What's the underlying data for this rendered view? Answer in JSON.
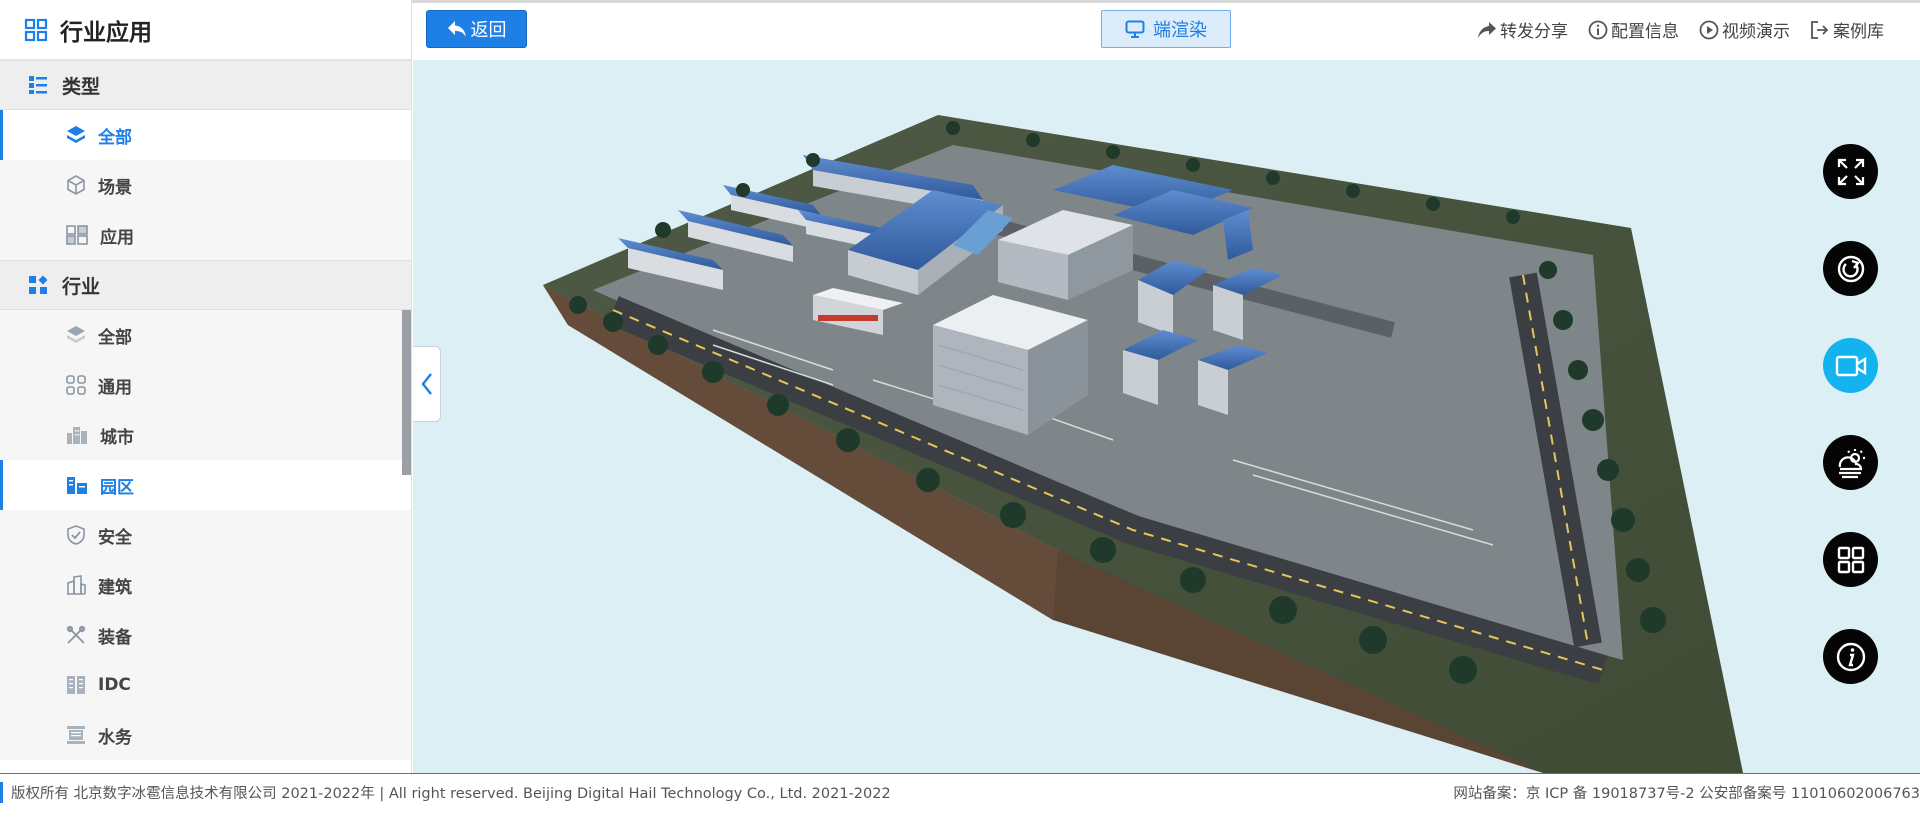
{
  "sidebar": {
    "header_icon": "grid-icon",
    "title": "行业应用",
    "groups": [
      {
        "label": "类型",
        "icon": "list-icon",
        "items": [
          {
            "label": "全部",
            "icon": "layers-icon",
            "active": true
          },
          {
            "label": "场景",
            "icon": "cube-icon",
            "active": false
          },
          {
            "label": "应用",
            "icon": "apps-icon",
            "active": false
          }
        ]
      },
      {
        "label": "行业",
        "icon": "category-icon",
        "items": [
          {
            "label": "全部",
            "icon": "layers-icon",
            "active": false
          },
          {
            "label": "通用",
            "icon": "grid-small-icon",
            "active": false
          },
          {
            "label": "城市",
            "icon": "city-icon",
            "active": false
          },
          {
            "label": "园区",
            "icon": "park-icon",
            "active": true
          },
          {
            "label": "安全",
            "icon": "shield-icon",
            "active": false
          },
          {
            "label": "建筑",
            "icon": "building-icon",
            "active": false
          },
          {
            "label": "装备",
            "icon": "equipment-icon",
            "active": false
          },
          {
            "label": "IDC",
            "icon": "server-icon",
            "active": false
          },
          {
            "label": "水务",
            "icon": "water-icon",
            "active": false
          }
        ]
      }
    ]
  },
  "topbar": {
    "back_label": "返回",
    "render_label": "端渲染",
    "links": [
      {
        "label": "转发分享",
        "icon": "share-icon"
      },
      {
        "label": "配置信息",
        "icon": "info-icon"
      },
      {
        "label": "视频演示",
        "icon": "play-icon"
      },
      {
        "label": "案例库",
        "icon": "exit-icon"
      }
    ]
  },
  "tools": [
    {
      "name": "fullscreen-icon",
      "active": false
    },
    {
      "name": "rotate-icon",
      "active": false
    },
    {
      "name": "camera-icon",
      "active": true
    },
    {
      "name": "weather-icon",
      "active": false
    },
    {
      "name": "grid-icon",
      "active": false
    },
    {
      "name": "info-icon",
      "active": false
    }
  ],
  "footer": {
    "copyright": "版权所有 北京数字冰雹信息技术有限公司 2021-2022年 | All right reserved. Beijing Digital Hail Technology Co., Ltd. 2021-2022",
    "icp": "网站备案：京 ICP 备 19018737号-2 公安部备案号 11010602006763"
  },
  "colors": {
    "accent": "#1e7fe6",
    "tool_active": "#12b3ef",
    "scene_bg": "#dbeff5"
  }
}
